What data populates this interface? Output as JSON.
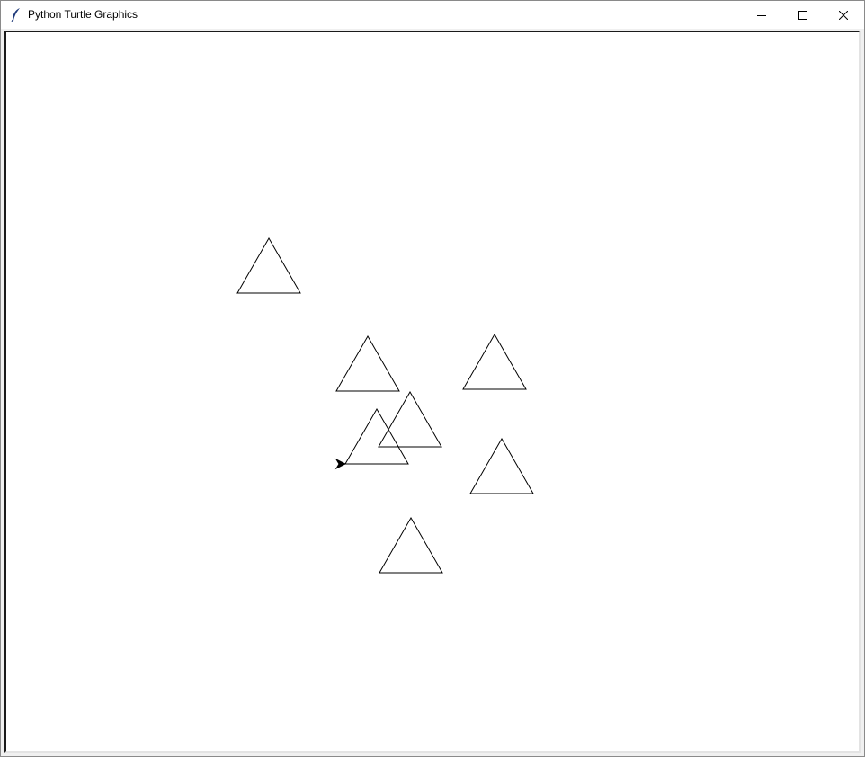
{
  "window": {
    "title": "Python Turtle Graphics",
    "icon": "feather-icon",
    "controls": {
      "minimize": "minimize-icon",
      "maximize": "maximize-icon",
      "close": "close-icon"
    }
  },
  "canvas": {
    "background": "#ffffff",
    "stroke_color": "#000000",
    "shapes": [
      {
        "type": "triangle"
      },
      {
        "type": "triangle"
      },
      {
        "type": "triangle"
      },
      {
        "type": "triangle"
      },
      {
        "type": "triangle"
      },
      {
        "type": "triangle"
      },
      {
        "type": "triangle"
      }
    ],
    "turtle": {
      "shape": "classic-arrow",
      "heading": "east"
    }
  }
}
